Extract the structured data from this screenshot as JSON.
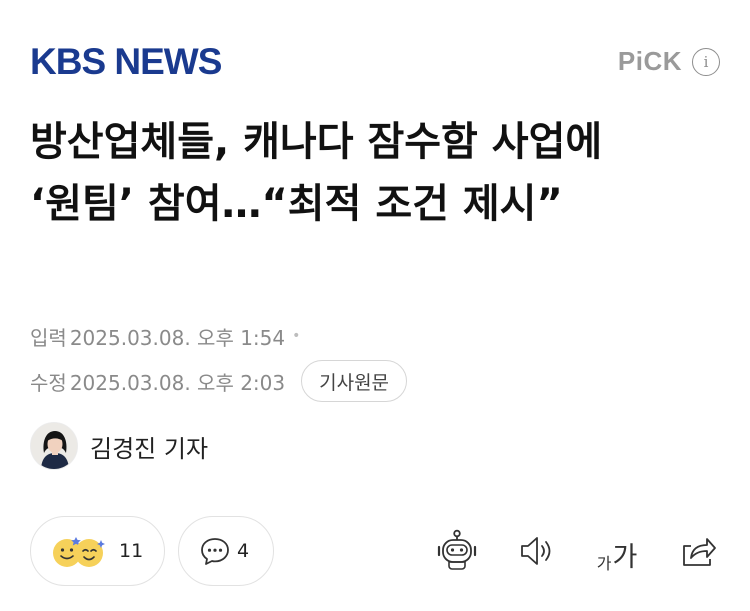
{
  "header": {
    "brand": "KBS NEWS",
    "pick_label": "PiCK",
    "info_icon": "info-icon"
  },
  "article": {
    "title": "방산업체들, 캐나다 잠수함 사업에 ‘원팀’ 참여…“최적 조건 제시”",
    "published_label": "입력",
    "published_at": "2025.03.08. 오후 1:54",
    "modified_label": "수정",
    "modified_at": "2025.03.08. 오후 2:03",
    "original_button": "기사원문"
  },
  "reporter": {
    "name": "김경진 기자"
  },
  "engagement": {
    "reaction_count": "11",
    "comment_count": "4"
  },
  "toolbar": {
    "font_small": "가",
    "font_large": "가",
    "icons": [
      "robot-icon",
      "speaker-icon",
      "font-size-icon",
      "share-icon"
    ]
  },
  "colors": {
    "brand": "#1a3a8f",
    "muted": "#8a8a8a",
    "border": "#e2e2e2"
  }
}
